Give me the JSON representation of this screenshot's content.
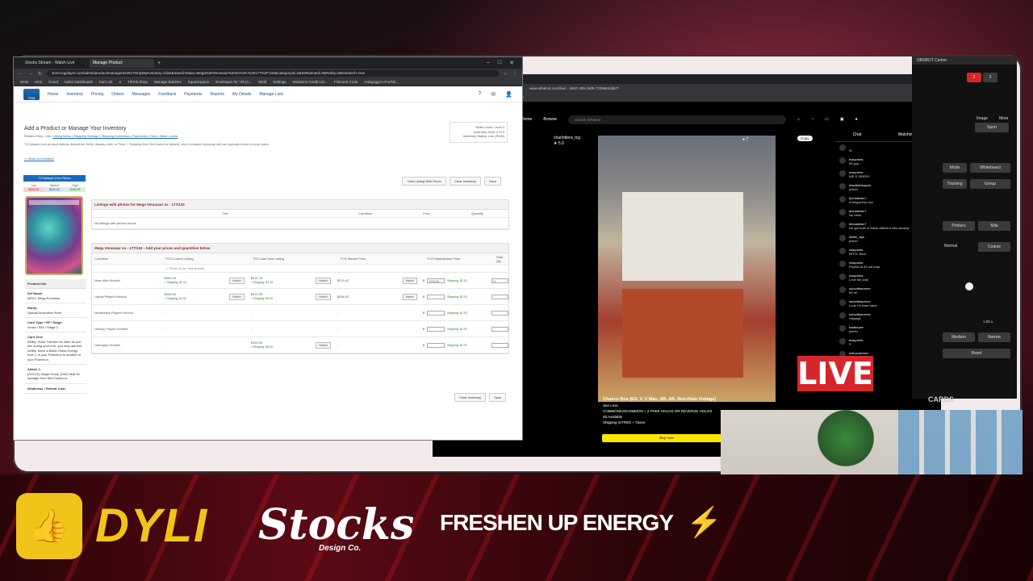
{
  "browser": {
    "tabs": [
      "Stocks Stream - Watch Live",
      "Manage Product"
    ],
    "url": "store.tcgplayer.com/admin/product/manage/63451?OnlyMyInventory=false&SearchValue=Mega%20Venusaur%20ex%20-%20177%2F132&CategoryId=3&SetNameId=0&Rarity=0&IsSearch=true",
    "bookmarks": [
      "Work",
      "Kick",
      "Gmail",
      "Seller Dashboard",
      "Cart List",
      "X",
      "TikTok Shop",
      "Manage Batches",
      "Squarespace",
      "Envelopes for \"All (A...",
      "Weld",
      "Settings",
      "Wisdoms Credit Uni...",
      "Filament Code",
      "Hobgoggo's Portfoli..."
    ]
  },
  "tcg": {
    "nav": [
      "Home",
      "Inventory",
      "Pricing",
      "Orders",
      "Messages",
      "Feedback",
      "Payments",
      "Reports",
      "My Details",
      "Manage Lists"
    ],
    "heading": "Add a Product or Manage Your Inventory",
    "related": "Related Help / Info:",
    "related_links": "Listing Items | Shipping Settings | Shipping Guidelines | Payments | Fees | Seller Levels",
    "note": "TCGplayer.com product listings default the Seller display order to Price + Shipping from the lowest to highest, and a cheaper shipping rate can typically result in more sales.",
    "back": "<< Back to Inventory",
    "seller": [
      "Seller Level: Level 4",
      "Inventory Total: 2,473",
      "Inventory Status: Live (PAID)"
    ],
    "live_prices": "TCGplayer Live Prices",
    "price_labels": [
      "Low",
      "Market",
      "High"
    ],
    "price_values": [
      "$205.00",
      "$220.00",
      "$499.99"
    ],
    "buttons": {
      "add_photo": "+Add Listing With Photo",
      "clear": "Clear Inventory",
      "save": "Save"
    },
    "photos_header": "Listings with photos for Mega Venusaur ex - 177/132",
    "photo_cols": [
      "Title",
      "Condition",
      "Price",
      "Quantity"
    ],
    "no_listings": "No listings with photos found.",
    "prices_header": "Mega Venusaur ex - 177/132 - Add your prices and quantities below",
    "cols": [
      "Condition",
      "TCG Lowest Listing",
      "TCG Last Sold Listing",
      "TCG Market Price",
      "TCG Marketplace Price",
      "Total Qty"
    ],
    "print_only": "Print, show, and special",
    "rows": [
      {
        "c": "Near Mint Holofoil",
        "low": "$200.00",
        "low_ship": "+ Shipping: $2.00",
        "sold": "$215.75",
        "sold_ship": "+ Shipping: $1.25",
        "market": "$219.42",
        "mp": "209.00",
        "mp_ship": "Shipping: $2.78",
        "qty": "0"
      },
      {
        "c": "Lightly Played Holofoil",
        "low": "$206.63",
        "low_ship": "+ Shipping: $1.50",
        "sold": "$215.95",
        "sold_ship": "+ Shipping: $0.00",
        "market": "$206.03",
        "mp": "",
        "mp_ship": "Shipping: $2.78",
        "qty": ""
      },
      {
        "c": "Moderately Played Holofoil",
        "low": "-",
        "low_ship": "",
        "sold": "-",
        "sold_ship": "",
        "market": "-",
        "mp": "",
        "mp_ship": "Shipping: $2.78",
        "qty": ""
      },
      {
        "c": "Heavily Played Holofoil",
        "low": "-",
        "low_ship": "",
        "sold": "-",
        "sold_ship": "",
        "market": "-",
        "mp": "",
        "mp_ship": "Shipping: $2.78",
        "qty": ""
      },
      {
        "c": "Damaged Holofoil",
        "low": "-",
        "low_ship": "",
        "sold": "$100.00",
        "sold_ship": "+ Shipping: $0.00",
        "market": "-",
        "mp": "",
        "mp_ship": "Shipping: $2.78",
        "qty": ""
      }
    ],
    "match": "Match",
    "info": {
      "title": "Product Info",
      "set_l": "Set Name:",
      "set": "ME01: Mega Evolution",
      "rarity_l": "Rarity:",
      "rarity": "Special Illustration Rare",
      "type_l": "Card Type / HP / Stage:",
      "type": "Grass / 340 / Stage 2",
      "text_l": "Card Text:",
      "text": "Ability: Solar Transfer As often as you like during your turn, you may use this Ability. Move a Basic Grass Energy from 1 of your Pokemon to another of your Pokemon.",
      "atk_l": "Attack 1:",
      "atk": "[GGGG] Jungle Dump (240) Heal 30 damage from this Pokemon.",
      "weak_l": "Weakness / Retreat Cost:"
    }
  },
  "whatnot": {
    "nav": [
      "Home",
      "Browse"
    ],
    "search": "Search Whatnot",
    "streamer": "charlottera_tcg",
    "rating": "5.0",
    "live_count": "7",
    "copy": "Copy",
    "shop_title": "Chance Box (EX, V, V Max, SR, AR, Non-Holo Vintage)",
    "shop_sub": "See Less",
    "shop_line": "COMMON/UNCOMMON + 2 FREE HOLOS OR REVERSE HOLOS",
    "available": "48 Available",
    "shipping": "Shipping is FREE + Taxes",
    "buy": "Buy now",
    "chat_tabs": [
      "Chat",
      "Watching"
    ],
    "messages": [
      {
        "u": "",
        "t": "W"
      },
      {
        "u": "macprints",
        "t": "tf3 guy..."
      },
      {
        "u": "macprints",
        "t": "WE S SIRES!!"
      },
      {
        "u": "hfanthefanacdc",
        "t": "joined"
      },
      {
        "u": "dinnadesin?",
        "t": "A Megavenu rice"
      },
      {
        "u": "dinnadesin7",
        "t": "Nn Hello"
      },
      {
        "u": "dinnadesin7",
        "t": "Ive got both of these different sets already"
      },
      {
        "u": "sbiller_tips",
        "t": "joined"
      },
      {
        "u": "macprints",
        "t": "BFFV! Nice!"
      },
      {
        "u": "macprints",
        "t": "Phobia at 43 out total"
      },
      {
        "u": "macprints",
        "t": "Love the post"
      },
      {
        "u": "subvdtbaczeev",
        "t": "W+w!"
      },
      {
        "u": "subvdtbaczeev",
        "t": "Look I'm back haha"
      },
      {
        "u": "subvdtbaczeev",
        "t": "Hiaaage"
      },
      {
        "u": "hawkeyez",
        "t": "joined"
      },
      {
        "u": "macprints",
        "t": "S"
      },
      {
        "u": "wild.pokemon",
        "t": "joined"
      }
    ]
  },
  "obs": {
    "title": "OBSBOT Center",
    "labels": [
      "Image",
      "More",
      "Sport",
      "Mode",
      "Whiteboard",
      "Tracking",
      "Group",
      "Printers",
      "Mila",
      "Normal",
      "Coarse",
      "Medium",
      "Narrow",
      "Reset"
    ],
    "zoom": "1.00 x",
    "active": "2",
    "other": "3"
  },
  "overlay": {
    "live": "LIVE",
    "cards": "CARDS"
  },
  "sponsors": {
    "dyli": "DYLI",
    "stocks": "Stocks",
    "stocks_sub": "Design Co.",
    "fresh": "FRESHEN UP ENERGY"
  },
  "colors": {
    "live_red": "#d6262c",
    "dyli_yellow": "#f0c419",
    "whatnot_yellow": "#ffe500",
    "tcg_blue": "#1a6aba"
  }
}
